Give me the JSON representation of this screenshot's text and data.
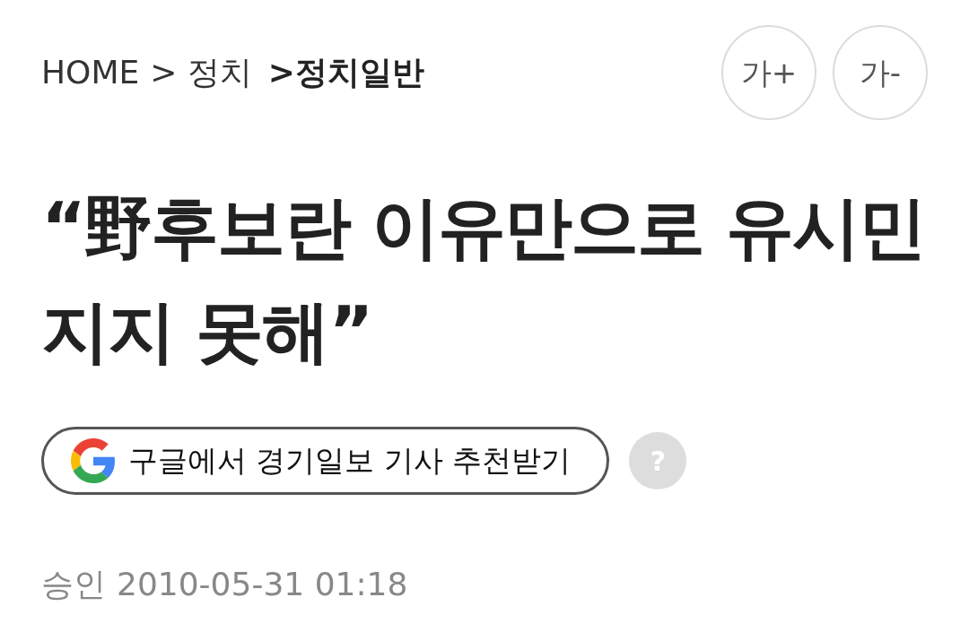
{
  "breadcrumb": [
    {
      "label": "HOME",
      "selected": false
    },
    {
      "label": "> 정치",
      "selected": false
    },
    {
      "label": ">정치일반",
      "selected": true
    }
  ],
  "text_size_buttons": [
    "가+",
    "가-"
  ],
  "headline": "“野후보란 이유만으로 유시민 지지 못해”",
  "google_recommend": {
    "label": "구글에서 경기일보 기사 추천받기"
  },
  "help": {
    "label": "?"
  },
  "approval": {
    "label": "승인",
    "datetime": "2010-05-31 01:18"
  }
}
